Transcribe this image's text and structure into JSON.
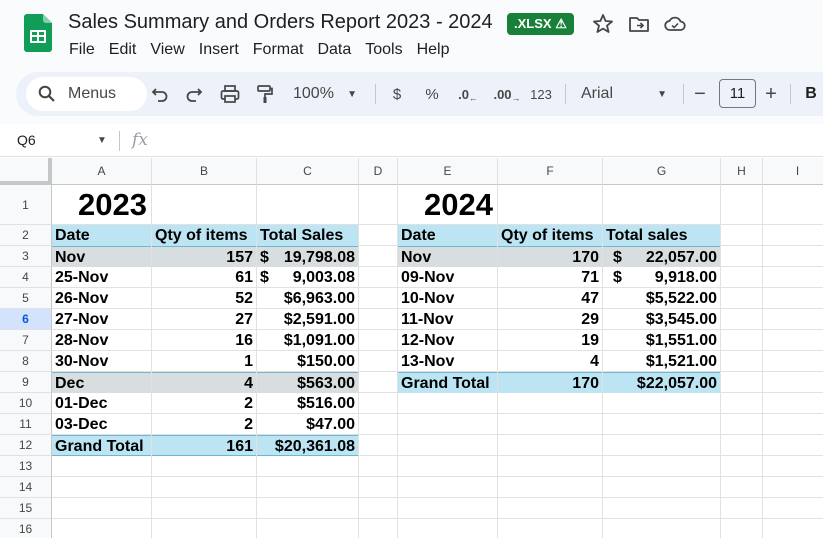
{
  "doc": {
    "title": "Sales Summary and Orders Report 2023 - 2024",
    "badge": ".XLSX",
    "badge_warning_icon": "warning-icon",
    "menu": [
      "File",
      "Edit",
      "View",
      "Insert",
      "Format",
      "Data",
      "Tools",
      "Help"
    ]
  },
  "toolbar": {
    "search_label": "Menus",
    "zoom": "100%",
    "currency": "$",
    "percent": "%",
    "decrease_decimal": ".0",
    "increase_decimal": ".00",
    "number_format": "123",
    "font": "Arial",
    "font_size": "11",
    "minus": "−",
    "plus": "+",
    "bold": "B"
  },
  "formula_bar": {
    "name_box": "Q6",
    "fx": "fx"
  },
  "grid": {
    "columns": [
      "A",
      "B",
      "C",
      "D",
      "E",
      "F",
      "G",
      "H",
      "I"
    ],
    "rows": [
      "1",
      "2",
      "3",
      "4",
      "5",
      "6",
      "7",
      "8",
      "9",
      "10",
      "11",
      "12",
      "13",
      "14",
      "15",
      "16"
    ],
    "selected_row": "6",
    "colors": {
      "header_fill": "#bde4f3",
      "group_fill": "#d8dee0",
      "border": "#6fb8d5"
    }
  },
  "table_2023": {
    "year": "2023",
    "headers": [
      "Date",
      "Qty of items",
      "Total Sales"
    ],
    "rows": [
      {
        "date": "Nov",
        "qty": "157",
        "cur": "$",
        "amt": "19,798.08"
      },
      {
        "date": "25-Nov",
        "qty": "61",
        "cur": "$",
        "amt": "9,003.08"
      },
      {
        "date": "26-Nov",
        "qty": "52",
        "cur": "",
        "amt": "$6,963.00"
      },
      {
        "date": "27-Nov",
        "qty": "27",
        "cur": "",
        "amt": "$2,591.00"
      },
      {
        "date": "28-Nov",
        "qty": "16",
        "cur": "",
        "amt": "$1,091.00"
      },
      {
        "date": "30-Nov",
        "qty": "1",
        "cur": "",
        "amt": "$150.00"
      },
      {
        "date": "Dec",
        "qty": "4",
        "cur": "",
        "amt": "$563.00"
      },
      {
        "date": "01-Dec",
        "qty": "2",
        "cur": "",
        "amt": "$516.00"
      },
      {
        "date": "03-Dec",
        "qty": "2",
        "cur": "",
        "amt": "$47.00"
      },
      {
        "date": "Grand Total",
        "qty": "161",
        "cur": "",
        "amt": "$20,361.08"
      }
    ]
  },
  "table_2024": {
    "year": "2024",
    "headers": [
      "Date",
      "Qty of items",
      "Total sales"
    ],
    "rows": [
      {
        "date": "Nov",
        "qty": "170",
        "cur": "$",
        "amt": "22,057.00"
      },
      {
        "date": "09-Nov",
        "qty": "71",
        "cur": "$",
        "amt": "9,918.00"
      },
      {
        "date": "10-Nov",
        "qty": "47",
        "cur": "",
        "amt": "$5,522.00"
      },
      {
        "date": "11-Nov",
        "qty": "29",
        "cur": "",
        "amt": "$3,545.00"
      },
      {
        "date": "12-Nov",
        "qty": "19",
        "cur": "",
        "amt": "$1,551.00"
      },
      {
        "date": "13-Nov",
        "qty": "4",
        "cur": "",
        "amt": "$1,521.00"
      },
      {
        "date": "Grand Total",
        "qty": "170",
        "cur": "",
        "amt": "$22,057.00"
      }
    ]
  }
}
